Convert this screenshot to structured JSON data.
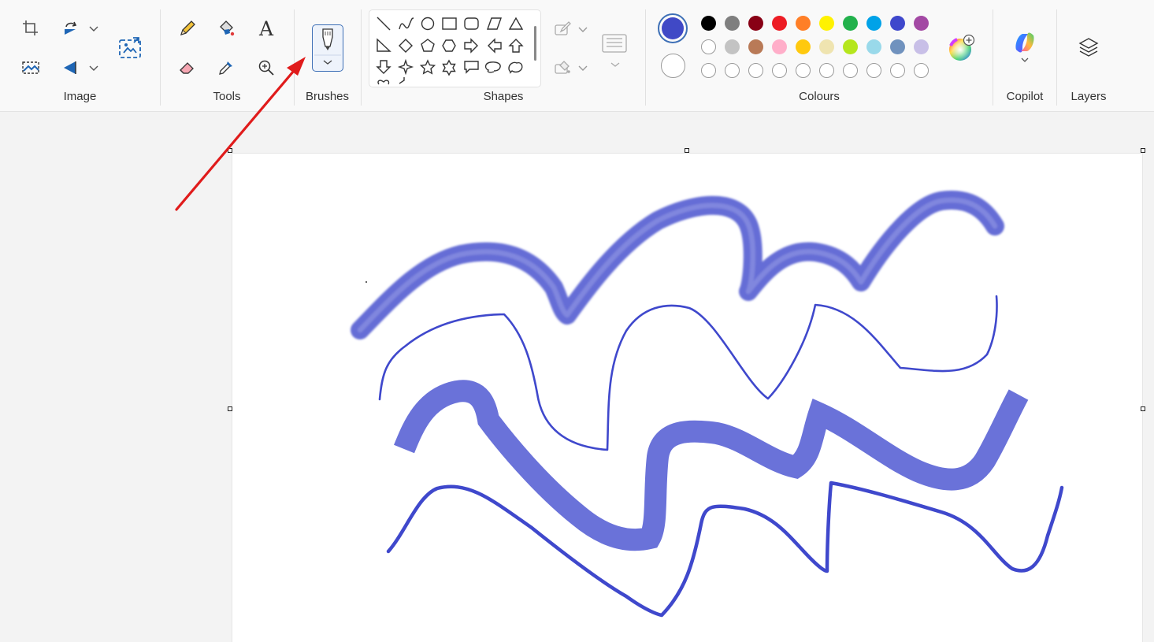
{
  "ribbon": {
    "groups": {
      "image": "Image",
      "tools": "Tools",
      "brushes": "Brushes",
      "shapes": "Shapes",
      "colours": "Colours",
      "copilot": "Copilot",
      "layers": "Layers"
    },
    "text_tool_glyph": "A"
  },
  "colours": {
    "primary": "#4049c6",
    "secondary": "#ffffff",
    "palette": [
      "#000000",
      "#7f7f7f",
      "#880015",
      "#ed1c24",
      "#ff7f27",
      "#fff200",
      "#22b14c",
      "#00a2e8",
      "#3f48cc",
      "#a349a4",
      "#ffffff",
      "#c3c3c3",
      "#b97a57",
      "#ffaec9",
      "#ffc90e",
      "#efe4b0",
      "#b5e61d",
      "#99d9ea",
      "#7092be",
      "#c8bfe7"
    ],
    "custom_slots": 10
  },
  "canvas": {
    "stroke_colour_dark": "#3f48cc",
    "stroke_colour_light": "#6d74d9"
  },
  "annotation": {
    "arrow_colour": "#e01b1b"
  }
}
